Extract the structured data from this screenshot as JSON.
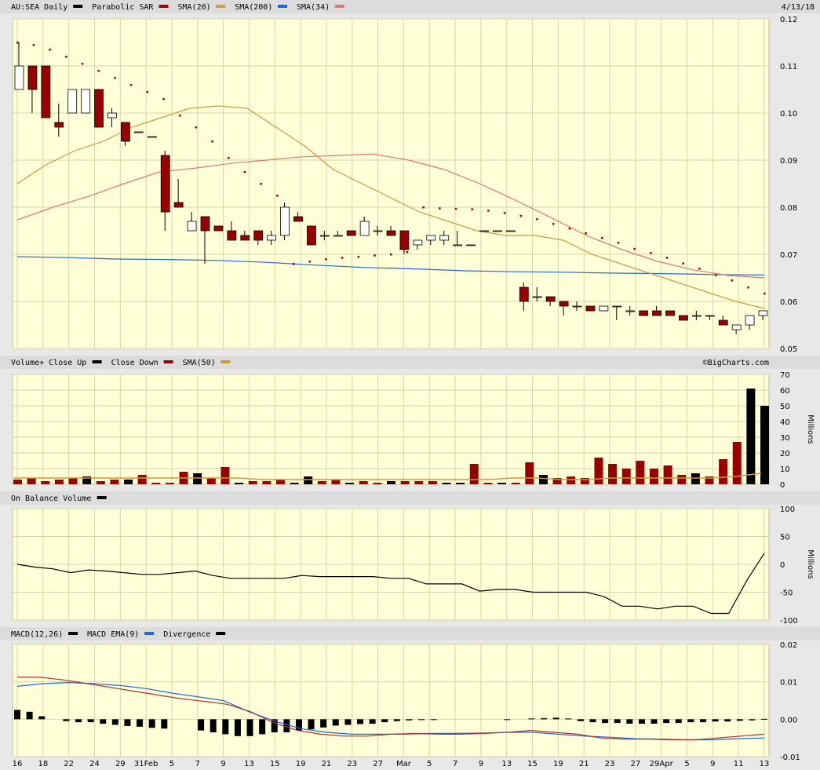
{
  "date": "4/13/18",
  "watermark": "©BigCharts.com",
  "colors": {
    "bg": "#ffffd8",
    "panel_hdr": "#dcdcdc",
    "grid": "#d6d6a8",
    "up": "#000000",
    "down": "#990000",
    "sma20": "#cc9944",
    "sma200": "#2266dd",
    "sma34": "#dd7777",
    "psar": "#990000",
    "vol_sma": "#cc9944",
    "macd": "#2266dd",
    "macd_ema": "#aa3333",
    "div": "#000000"
  },
  "chart_data": [
    {
      "type": "candlestick",
      "title": "AU:SEA Daily",
      "legend": [
        {
          "name": "AU:SEA Daily",
          "color": "#000000"
        },
        {
          "name": "Parabolic SAR",
          "color": "#990000"
        },
        {
          "name": "SMA(20)",
          "color": "#cc9944"
        },
        {
          "name": "SMA(200)",
          "color": "#2266dd"
        },
        {
          "name": "SMA(34)",
          "color": "#dd7777"
        }
      ],
      "ylim": [
        0.05,
        0.12
      ],
      "yticks": [
        "0.12",
        "0.11",
        "0.10",
        "0.09",
        "0.08",
        "0.07",
        "0.06",
        "0.05"
      ],
      "x_labels": [
        "16",
        "18",
        "22",
        "24",
        "29",
        "31Feb",
        "5",
        "7",
        "9",
        "13",
        "15",
        "19",
        "21",
        "23",
        "27",
        "Mar",
        "5",
        "7",
        "9",
        "13",
        "15",
        "19",
        "21",
        "23",
        "27",
        "29Apr",
        "5",
        "9",
        "11",
        "13"
      ],
      "candles": [
        [
          0.105,
          0.115,
          0.105,
          0.11
        ],
        [
          0.11,
          0.11,
          0.1,
          0.105
        ],
        [
          0.11,
          0.11,
          0.099,
          0.099
        ],
        [
          0.098,
          0.102,
          0.095,
          0.097
        ],
        [
          0.1,
          0.105,
          0.1,
          0.105
        ],
        [
          0.1,
          0.105,
          0.1,
          0.105
        ],
        [
          0.105,
          0.105,
          0.097,
          0.097
        ],
        [
          0.099,
          0.101,
          0.097,
          0.1
        ],
        [
          0.098,
          0.098,
          0.093,
          0.094
        ],
        [
          0.096,
          0.096,
          0.096,
          0.096
        ],
        [
          0.095,
          0.095,
          0.095,
          0.095
        ],
        [
          0.091,
          0.092,
          0.075,
          0.079
        ],
        [
          0.081,
          0.086,
          0.08,
          0.08
        ],
        [
          0.075,
          0.079,
          0.075,
          0.077
        ],
        [
          0.078,
          0.078,
          0.068,
          0.075
        ],
        [
          0.076,
          0.076,
          0.075,
          0.075
        ],
        [
          0.075,
          0.077,
          0.073,
          0.073
        ],
        [
          0.074,
          0.075,
          0.073,
          0.073
        ],
        [
          0.075,
          0.075,
          0.072,
          0.073
        ],
        [
          0.073,
          0.075,
          0.072,
          0.074
        ],
        [
          0.074,
          0.081,
          0.073,
          0.08
        ],
        [
          0.078,
          0.079,
          0.077,
          0.077
        ],
        [
          0.076,
          0.076,
          0.072,
          0.072
        ],
        [
          0.074,
          0.075,
          0.073,
          0.074
        ],
        [
          0.074,
          0.075,
          0.074,
          0.074
        ],
        [
          0.075,
          0.075,
          0.074,
          0.074
        ],
        [
          0.074,
          0.078,
          0.074,
          0.077
        ],
        [
          0.075,
          0.076,
          0.074,
          0.075
        ],
        [
          0.075,
          0.076,
          0.074,
          0.074
        ],
        [
          0.075,
          0.075,
          0.07,
          0.071
        ],
        [
          0.072,
          0.073,
          0.071,
          0.073
        ],
        [
          0.073,
          0.073,
          0.072,
          0.074
        ],
        [
          0.073,
          0.075,
          0.072,
          0.074
        ],
        [
          0.072,
          0.075,
          0.072,
          0.072
        ],
        [
          0.072,
          0.072,
          0.072,
          0.072
        ],
        [
          0.075,
          0.075,
          0.075,
          0.075
        ],
        [
          0.075,
          0.075,
          0.075,
          0.075
        ],
        [
          0.075,
          0.075,
          0.075,
          0.075
        ],
        [
          0.063,
          0.064,
          0.058,
          0.06
        ],
        [
          0.061,
          0.063,
          0.06,
          0.061
        ],
        [
          0.061,
          0.061,
          0.059,
          0.06
        ],
        [
          0.06,
          0.06,
          0.057,
          0.059
        ],
        [
          0.059,
          0.06,
          0.058,
          0.059
        ],
        [
          0.059,
          0.059,
          0.058,
          0.058
        ],
        [
          0.058,
          0.059,
          0.058,
          0.059
        ],
        [
          0.059,
          0.059,
          0.056,
          0.059
        ],
        [
          0.058,
          0.059,
          0.057,
          0.058
        ],
        [
          0.058,
          0.058,
          0.057,
          0.057
        ],
        [
          0.058,
          0.059,
          0.057,
          0.057
        ],
        [
          0.058,
          0.058,
          0.057,
          0.057
        ],
        [
          0.057,
          0.057,
          0.056,
          0.056
        ],
        [
          0.057,
          0.058,
          0.056,
          0.057
        ],
        [
          0.057,
          0.057,
          0.056,
          0.057
        ],
        [
          0.056,
          0.057,
          0.055,
          0.055
        ],
        [
          0.054,
          0.055,
          0.053,
          0.055
        ],
        [
          0.055,
          0.057,
          0.054,
          0.057
        ],
        [
          0.057,
          0.058,
          0.056,
          0.058
        ]
      ],
      "sma20": [
        0.085,
        0.089,
        0.092,
        0.094,
        0.097,
        0.099,
        0.101,
        0.1015,
        0.101,
        0.097,
        0.093,
        0.088,
        0.085,
        0.082,
        0.079,
        0.077,
        0.075,
        0.074,
        0.074,
        0.073,
        0.07,
        0.068,
        0.066,
        0.064,
        0.062,
        0.06,
        0.0585
      ],
      "sma200": [
        0.0695,
        0.0693,
        0.069,
        0.0689,
        0.0687,
        0.0683,
        0.0677,
        0.0672,
        0.0669,
        0.0665,
        0.0663,
        0.0662,
        0.066,
        0.0659,
        0.0657,
        0.0656
      ],
      "sma34": [
        0.0773,
        0.08,
        0.0823,
        0.085,
        0.0875,
        0.0883,
        0.0893,
        0.09,
        0.0907,
        0.091,
        0.0913,
        0.09,
        0.088,
        0.085,
        0.0815,
        0.0778,
        0.074,
        0.071,
        0.0685,
        0.0667,
        0.0655,
        0.065
      ],
      "psar": [
        0.115,
        0.1145,
        0.1135,
        0.112,
        0.1105,
        0.109,
        0.1075,
        0.106,
        0.1045,
        0.103,
        0.0995,
        0.097,
        0.094,
        0.0905,
        0.0875,
        0.085,
        0.0825,
        0.068,
        0.0685,
        0.069,
        0.0693,
        0.0695,
        0.0698,
        0.07,
        0.0705,
        0.08,
        0.0798,
        0.0797,
        0.0796,
        0.0793,
        0.0788,
        0.0782,
        0.0775,
        0.0765,
        0.0755,
        0.0745,
        0.0735,
        0.0725,
        0.0712,
        0.0703,
        0.0693,
        0.0681,
        0.067,
        0.0656,
        0.0645,
        0.063,
        0.0617
      ]
    },
    {
      "type": "bar",
      "title": "Volume+",
      "legend": [
        {
          "name": "Close Up",
          "color": "#000000"
        },
        {
          "name": "Close Down",
          "color": "#990000"
        },
        {
          "name": "SMA(50)",
          "color": "#cc9944"
        }
      ],
      "ylabel": "Millions",
      "ylim": [
        0,
        70
      ],
      "yticks": [
        "70",
        "60",
        "50",
        "40",
        "30",
        "20",
        "10",
        "0"
      ],
      "values": [
        3,
        4,
        2,
        3,
        4,
        5,
        2,
        3,
        3,
        6,
        1,
        1,
        8,
        7,
        4,
        11,
        1,
        2,
        2,
        3,
        1,
        5,
        2,
        3,
        1,
        2,
        1,
        2,
        2,
        2,
        2,
        1,
        1,
        13,
        1,
        1,
        1,
        14,
        6,
        4,
        5,
        4,
        17,
        13,
        10,
        15,
        10,
        12,
        6,
        7,
        5,
        16,
        27,
        61,
        50
      ],
      "up": [
        false,
        false,
        false,
        false,
        false,
        true,
        false,
        false,
        true,
        false,
        false,
        false,
        false,
        true,
        false,
        false,
        true,
        false,
        false,
        false,
        true,
        true,
        false,
        false,
        true,
        false,
        false,
        true,
        false,
        false,
        false,
        true,
        true,
        false,
        false,
        true,
        false,
        false,
        true,
        false,
        false,
        false,
        false,
        false,
        false,
        false,
        false,
        false,
        false,
        true,
        false,
        false,
        false,
        true,
        true
      ],
      "sma50": [
        4,
        4,
        4,
        4,
        4,
        4,
        4,
        4,
        4,
        4,
        3,
        3,
        3,
        3,
        3,
        3,
        3,
        3,
        3,
        3,
        4,
        4,
        3,
        3,
        4,
        4,
        4,
        4,
        4,
        5,
        7
      ]
    },
    {
      "type": "line",
      "title": "On Balance Volume",
      "ylabel": "Millions",
      "ylim": [
        -100,
        100
      ],
      "yticks": [
        "100",
        "50",
        "0",
        "-50",
        "-100"
      ],
      "values": [
        0,
        -5,
        -8,
        -15,
        -10,
        -12,
        -15,
        -18,
        -18,
        -15,
        -12,
        -20,
        -25,
        -25,
        -25,
        -25,
        -20,
        -22,
        -22,
        -22,
        -22,
        -25,
        -25,
        -35,
        -35,
        -35,
        -48,
        -45,
        -45,
        -50,
        -50,
        -50,
        -50,
        -58,
        -75,
        -75,
        -80,
        -75,
        -75,
        -88,
        -88,
        -30,
        20
      ]
    },
    {
      "type": "line",
      "title": "MACD(12,26)",
      "legend": [
        {
          "name": "MACD(12,26)",
          "color": "#000000"
        },
        {
          "name": "MACD EMA(9)",
          "color": "#2266dd"
        },
        {
          "name": "Divergence",
          "color": "#000000"
        }
      ],
      "ylim": [
        -0.01,
        0.02
      ],
      "yticks": [
        "0.02",
        "0.01",
        "0.00",
        "-0.01"
      ],
      "macd": [
        0.0113,
        0.0112,
        0.0105,
        0.0095,
        0.0085,
        0.0075,
        0.0065,
        0.0055,
        0.0048,
        0.004,
        0.002,
        -0.001,
        -0.003,
        -0.004,
        -0.0045,
        -0.0045,
        -0.004,
        -0.0038,
        -0.004,
        -0.004,
        -0.0038,
        -0.0035,
        -0.003,
        -0.0035,
        -0.004,
        -0.005,
        -0.0053,
        -0.0053,
        -0.0055,
        -0.0055,
        -0.005,
        -0.0045,
        -0.004
      ],
      "macd_ema": [
        0.0088,
        0.0095,
        0.0098,
        0.0095,
        0.009,
        0.0082,
        0.007,
        0.006,
        0.005,
        0.002,
        -0.0005,
        -0.0025,
        -0.0035,
        -0.004,
        -0.004,
        -0.004,
        -0.0038,
        -0.0038,
        -0.0037,
        -0.0035,
        -0.0035,
        -0.004,
        -0.0045,
        -0.0048,
        -0.0052,
        -0.0053,
        -0.0055,
        -0.0055,
        -0.0052,
        -0.005
      ],
      "divergence": [
        0.0025,
        0.002,
        0.0008,
        0,
        -0.0005,
        -0.0008,
        -0.0008,
        -0.0012,
        -0.0015,
        -0.0018,
        -0.002,
        -0.0023,
        -0.0025,
        0,
        0,
        -0.003,
        -0.0035,
        -0.004,
        -0.0045,
        -0.0045,
        -0.004,
        -0.0035,
        -0.0035,
        -0.003,
        -0.0027,
        -0.0022,
        -0.0017,
        -0.0015,
        -0.0013,
        -0.0012,
        -0.0008,
        -0.0005,
        -0.0003,
        -0.0002,
        -0.0001,
        0,
        0,
        0,
        0,
        0,
        -0.0001,
        0,
        0.0002,
        0.0003,
        0.0004,
        0.0002,
        -0.0005,
        -0.0008,
        -0.001,
        -0.001,
        -0.0012,
        -0.0012,
        -0.0012,
        -0.001,
        -0.001,
        -0.0008,
        -0.0008,
        -0.0006,
        -0.0006,
        -0.0004,
        -0.0003,
        0.0001
      ]
    }
  ]
}
